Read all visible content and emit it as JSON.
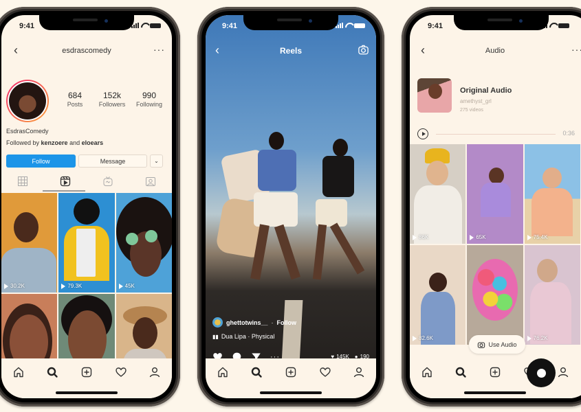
{
  "status_time": "9:41",
  "profile": {
    "username": "esdrascomedy",
    "stats": [
      {
        "value": "684",
        "label": "Posts"
      },
      {
        "value": "152k",
        "label": "Followers"
      },
      {
        "value": "990",
        "label": "Following"
      }
    ],
    "display_name": "EsdrasComedy",
    "followed_by_prefix": "Followed by",
    "followed_by_user1": "kenzoere",
    "followed_by_and": "and",
    "followed_by_user2": "eloears",
    "follow_label": "Follow",
    "message_label": "Message",
    "dropdown_icon": "chevron-down-icon",
    "tabs": [
      "grid-icon",
      "reels-icon",
      "igtv-icon",
      "tagged-icon"
    ],
    "active_tab": "reels-icon",
    "grid": [
      {
        "views": "30.2K",
        "bg": "#e09a3a"
      },
      {
        "views": "79.3K",
        "bg": "#2d8fd3"
      },
      {
        "views": "45K",
        "bg": "#4ea2d8"
      },
      {
        "views": "",
        "bg": "#c87e5a"
      },
      {
        "views": "",
        "bg": "#6f8a78"
      },
      {
        "views": "",
        "bg": "#d9b58a"
      }
    ]
  },
  "reels": {
    "title": "Reels",
    "author": "ghettotwins__",
    "separator": "·",
    "follow_label": "Follow",
    "song": "Dua Lipa · Physical",
    "likes": "145K",
    "comments": "190"
  },
  "audio": {
    "title": "Audio",
    "track_title": "Original Audio",
    "track_user": "amethyst_grl",
    "video_count": "275 videos",
    "duration": "0:36",
    "use_audio_label": "Use Audio",
    "grid": [
      {
        "views": "86K",
        "bg": "#d6cfc5"
      },
      {
        "views": "65K",
        "bg": "#b38ac8"
      },
      {
        "views": "75.4K",
        "bg": "#f0b48a"
      },
      {
        "views": "82.6K",
        "bg": "#e9d8c6"
      },
      {
        "views": "",
        "bg": "#b7a99a"
      },
      {
        "views": "76.2K",
        "bg": "#d9c4d0"
      }
    ]
  },
  "tabbar": [
    "home-icon",
    "search-icon",
    "new-post-icon",
    "activity-heart-icon",
    "profile-icon"
  ]
}
